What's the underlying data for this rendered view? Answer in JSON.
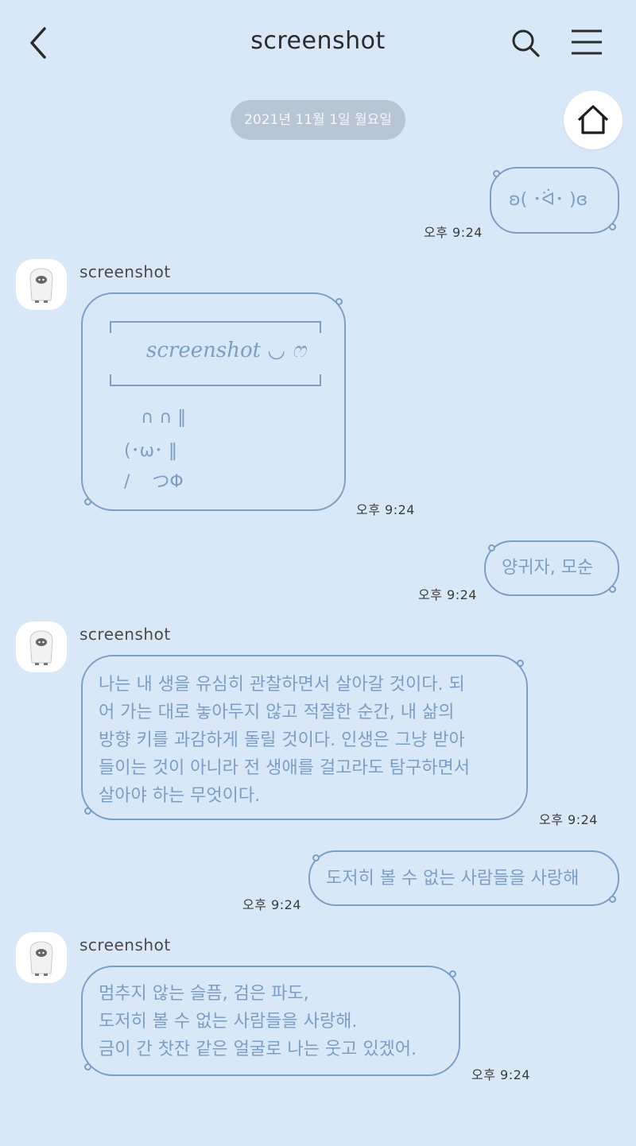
{
  "header": {
    "title": "screenshot"
  },
  "date_pill": "2021년 11월 1일 월요일",
  "messages": [
    {
      "side": "right",
      "text": "ʚ( ･ᐛ･ )ɞ",
      "time": "오후 9:24"
    },
    {
      "side": "left",
      "sender": "screenshot",
      "card_title": "screenshot ◡ ෆ",
      "art_lines": [
        "   ∩ ∩ ‖",
        "(･ω･ ‖",
        "/    つΦ"
      ],
      "time": "오후 9:24"
    },
    {
      "side": "right",
      "text": "양귀자, 모순",
      "time": "오후 9:24"
    },
    {
      "side": "left",
      "sender": "screenshot",
      "lines": [
        "나는 내 생을 유심히 관찰하면서 살아갈 것이다. 되",
        "어 가는 대로 놓아두지 않고 적절한 순간, 내 삶의",
        "방향 키를 과감하게 돌릴 것이다. 인생은 그냥 받아",
        "들이는 것이 아니라 전 생애를 걸고라도 탐구하면서",
        "살아야 하는 무엇이다."
      ],
      "time": "오후 9:24"
    },
    {
      "side": "right",
      "text": "도저히 볼 수 없는 사람들을 사랑해",
      "time": "오후 9:24"
    },
    {
      "side": "left",
      "sender": "screenshot",
      "lines": [
        "멈추지 않는 슬픔, 검은 파도,",
        "도저히 볼 수 없는 사람들을 사랑해.",
        "금이 간 찻잔 같은 얼굴로 나는 웃고 있겠어."
      ],
      "time": "오후 9:24"
    }
  ],
  "icons": [
    "back-arrow-icon",
    "search-icon",
    "menu-icon",
    "home-icon",
    "ghost-avatar-icon"
  ]
}
